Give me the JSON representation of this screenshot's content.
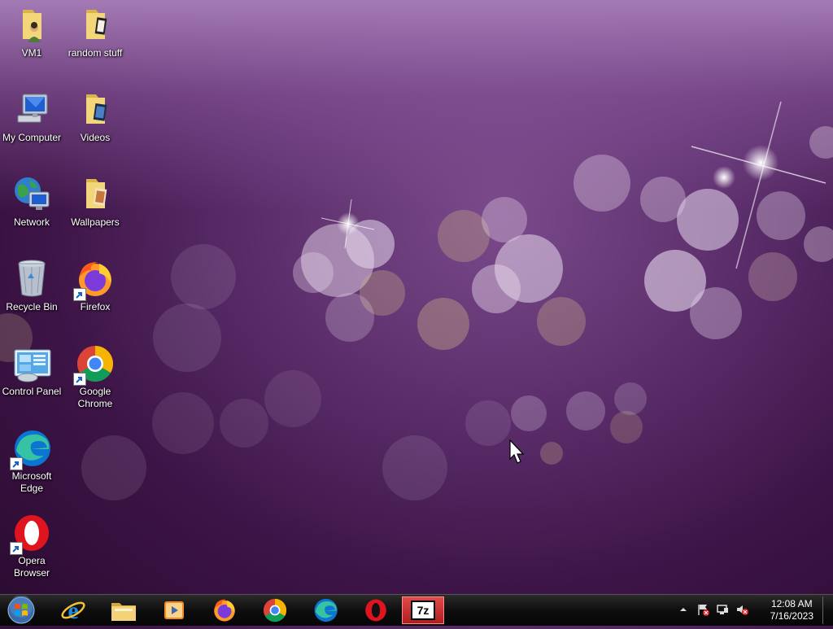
{
  "desktop": {
    "icons": [
      {
        "label": "VM1",
        "icon": "user-folder-icon"
      },
      {
        "label": "random stuff",
        "icon": "folder-icon"
      },
      {
        "label": "My Computer",
        "icon": "computer-icon"
      },
      {
        "label": "Videos",
        "icon": "folder-icon"
      },
      {
        "label": "Network",
        "icon": "network-icon"
      },
      {
        "label": "Wallpapers",
        "icon": "folder-icon"
      },
      {
        "label": "Recycle Bin",
        "icon": "recycle-bin-icon"
      },
      {
        "label": "Firefox",
        "icon": "firefox-icon"
      },
      {
        "label": "Control Panel",
        "icon": "control-panel-icon"
      },
      {
        "label": "Google Chrome",
        "icon": "chrome-icon"
      },
      {
        "label": "Microsoft Edge",
        "icon": "edge-icon"
      },
      {
        "label": "Opera Browser",
        "icon": "opera-icon"
      }
    ]
  },
  "taskbar": {
    "items": [
      {
        "name": "Internet Explorer",
        "icon": "ie-icon"
      },
      {
        "name": "File Explorer",
        "icon": "explorer-icon"
      },
      {
        "name": "Media Player",
        "icon": "media-player-icon"
      },
      {
        "name": "Firefox",
        "icon": "firefox-icon"
      },
      {
        "name": "Google Chrome",
        "icon": "chrome-icon"
      },
      {
        "name": "Microsoft Edge",
        "icon": "edge-icon"
      },
      {
        "name": "Opera",
        "icon": "opera-icon"
      },
      {
        "name": "7-Zip",
        "icon": "7zip-icon",
        "active": true,
        "text": "7z"
      }
    ],
    "clock": {
      "time": "12:08 AM",
      "date": "7/16/2023"
    }
  },
  "colors": {
    "taskbar": "#0e0e0e",
    "wallpaper": "#5a2d6a",
    "active_item": "#c02828"
  }
}
